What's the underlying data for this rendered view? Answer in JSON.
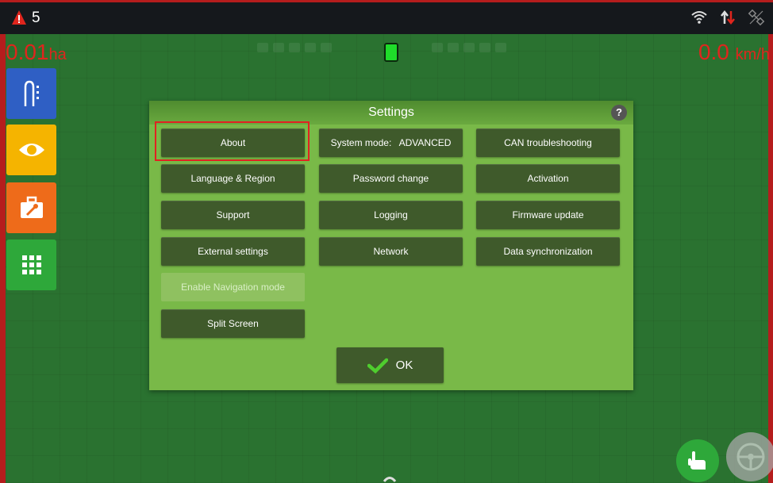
{
  "topbar": {
    "alert_count": "5",
    "icons": [
      "alert-triangle-icon",
      "wifi-icon",
      "data-transfer-icon",
      "satellite-off-icon"
    ]
  },
  "hud": {
    "area_value": "0.01",
    "area_unit": "ha",
    "speed_value": "0.0",
    "speed_unit": "km/h"
  },
  "sidebar": {
    "items": [
      {
        "icon": "guidance-lines-icon",
        "color": "#2f5fc4"
      },
      {
        "icon": "eye-icon",
        "color": "#f5b400"
      },
      {
        "icon": "toolbox-icon",
        "color": "#ee6b1a"
      },
      {
        "icon": "apps-grid-icon",
        "color": "#2ea83a"
      }
    ]
  },
  "settings": {
    "title": "Settings",
    "help": "?",
    "buttons": {
      "about": "About",
      "language_region": "Language & Region",
      "support": "Support",
      "external_settings": "External settings",
      "enable_navigation_mode": "Enable Navigation mode",
      "split_screen": "Split Screen",
      "system_mode": "System mode:   ADVANCED",
      "password_change": "Password change",
      "logging": "Logging",
      "network": "Network",
      "can_troubleshooting": "CAN troubleshooting",
      "activation": "Activation",
      "firmware_update": "Firmware update",
      "data_synchronization": "Data synchronization"
    },
    "ok_label": "OK"
  },
  "colors": {
    "alert_red": "#e0251d",
    "dialog_green": "#79b948",
    "button_dark": "#3f5a2b"
  }
}
